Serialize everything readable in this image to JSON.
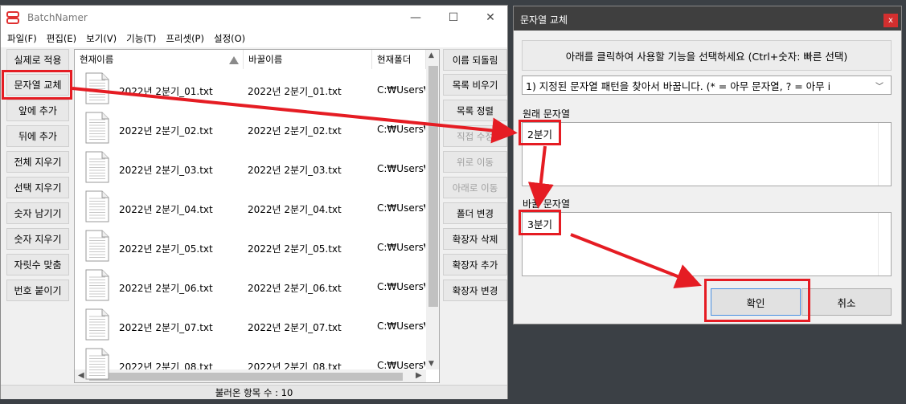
{
  "main": {
    "title": "BatchNamer",
    "window_controls": [
      "—",
      "☐",
      "✕"
    ],
    "menu": [
      "파일(F)",
      "편집(E)",
      "보기(V)",
      "기능(T)",
      "프리셋(P)",
      "설정(O)"
    ],
    "left_buttons": [
      "실제로 적용",
      "문자열 교체",
      "앞에 추가",
      "뒤에 추가",
      "전체 지우기",
      "선택 지우기",
      "숫자 남기기",
      "숫자 지우기",
      "자릿수 맞춤",
      "번호 붙이기"
    ],
    "right_buttons": [
      {
        "label": "이름 되돌림",
        "disabled": false
      },
      {
        "label": "목록 비우기",
        "disabled": false
      },
      {
        "label": "목록 정렬",
        "disabled": false
      },
      {
        "label": "직접 수정",
        "disabled": true
      },
      {
        "label": "위로 이동",
        "disabled": true
      },
      {
        "label": "아래로 이동",
        "disabled": true
      },
      {
        "label": "폴더 변경",
        "disabled": false
      },
      {
        "label": "확장자 삭제",
        "disabled": false
      },
      {
        "label": "확장자 추가",
        "disabled": false
      },
      {
        "label": "확장자 변경",
        "disabled": false
      }
    ],
    "columns": [
      "현재이름",
      "바꿀이름",
      "현재폴더"
    ],
    "rows": [
      {
        "current": "2022년 2분기_01.txt",
        "new": "2022년 2분기_01.txt",
        "folder": "C:₩Users₩"
      },
      {
        "current": "2022년 2분기_02.txt",
        "new": "2022년 2분기_02.txt",
        "folder": "C:₩Users₩"
      },
      {
        "current": "2022년 2분기_03.txt",
        "new": "2022년 2분기_03.txt",
        "folder": "C:₩Users₩"
      },
      {
        "current": "2022년 2분기_04.txt",
        "new": "2022년 2분기_04.txt",
        "folder": "C:₩Users₩"
      },
      {
        "current": "2022년 2분기_05.txt",
        "new": "2022년 2분기_05.txt",
        "folder": "C:₩Users₩"
      },
      {
        "current": "2022년 2분기_06.txt",
        "new": "2022년 2분기_06.txt",
        "folder": "C:₩Users₩"
      },
      {
        "current": "2022년 2분기_07.txt",
        "new": "2022년 2분기_07.txt",
        "folder": "C:₩Users₩"
      },
      {
        "current": "2022년 2분기_08.txt",
        "new": "2022년 2분기_08.txt",
        "folder": "C:₩Users₩"
      }
    ],
    "status": "불러온 항목 수 : 10"
  },
  "dialog": {
    "title": "문자열 교체",
    "close": "x",
    "instruction": "아래를 클릭하여 사용할 기능을 선택하세요 (Ctrl+숫자: 빠른 선택)",
    "mode": "1) 지정된 문자열 패턴을 찾아서 바꿉니다. (* = 아무 문자열, ? = 아무 i",
    "original_label": "원래 문자열",
    "original_value": "2분기",
    "replace_label": "바꿀 문자열",
    "replace_value": "3분기",
    "ok": "확인",
    "cancel": "취소"
  },
  "colors": {
    "highlight": "#e51c23",
    "accent": "#4a90e2"
  },
  "icons": [
    "app-logo-icon",
    "document-icon",
    "sort-up-icon",
    "chevron-down-icon",
    "close-icon"
  ]
}
